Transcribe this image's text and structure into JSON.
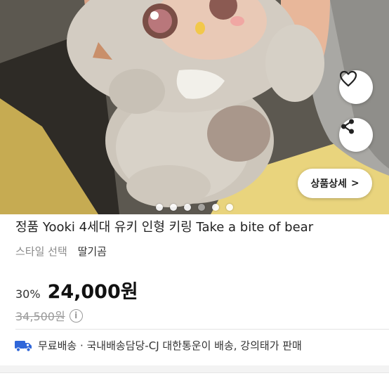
{
  "gallery": {
    "image_alt": "Yooki plush keyring photo",
    "slide_count": 6,
    "active_slide": 4,
    "detail_button_label": "상품상세",
    "detail_chevron": ">"
  },
  "actions": {
    "like_icon": "heart-icon",
    "share_icon": "share-icon"
  },
  "product": {
    "title": "정품 Yooki 4세대 유키 인형 키링 Take a bite of bear",
    "option_label": "스타일 선택",
    "option_value": "딸기곰",
    "discount": "30%",
    "price": "24,000원",
    "original_price": "34,500원",
    "info_icon_glyph": "i"
  },
  "shipping": {
    "icon": "truck-icon",
    "text": "무료배송 · 국내배송담당-CJ 대한통운이 배송, 강의태가 판매"
  },
  "colors": {
    "truck": "#2f66d9",
    "text": "#222222",
    "muted": "#8a8a8a"
  }
}
